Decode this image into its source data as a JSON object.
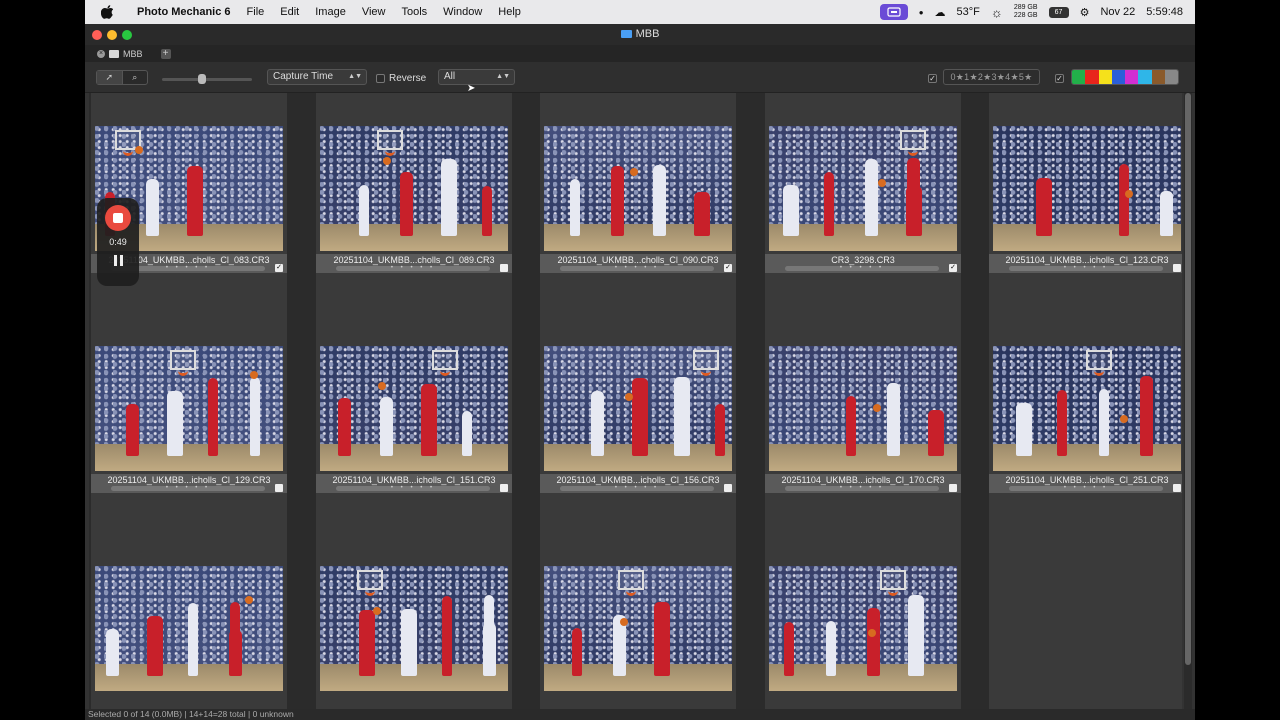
{
  "menubar": {
    "app_name": "Photo Mechanic 6",
    "items": [
      "File",
      "Edit",
      "Image",
      "View",
      "Tools",
      "Window",
      "Help"
    ],
    "temperature": "53°F",
    "storage_line1": "289 GB",
    "storage_line2": "228 GB",
    "battery": "67",
    "date": "Nov 22",
    "time": "5:59:48"
  },
  "window": {
    "title": "MBB",
    "tab_label": "MBB"
  },
  "toolbar": {
    "sort_value": "Capture Time",
    "reverse_label": "Reverse",
    "filter_value": "All",
    "stars_text": "0★1★2★3★4★5★",
    "color_labels": [
      "#22b04a",
      "#e8251c",
      "#f5e11b",
      "#2b5fd9",
      "#d22fd2",
      "#2fb6e8",
      "#8a5a2b",
      "#888888"
    ]
  },
  "recorder": {
    "elapsed": "0:49"
  },
  "cells": [
    {
      "filename": "20251104_UKMBB...cholls_Cl_083.CR3",
      "tagged": true
    },
    {
      "filename": "20251104_UKMBB...cholls_Cl_089.CR3",
      "tagged": false
    },
    {
      "filename": "20251104_UKMBB...cholls_Cl_090.CR3",
      "tagged": true
    },
    {
      "filename": "CR3_3298.CR3",
      "tagged": true
    },
    {
      "filename": "20251104_UKMBB...icholls_Cl_123.CR3",
      "tagged": false
    },
    {
      "filename": "20251104_UKMBB...icholls_Cl_129.CR3",
      "tagged": false
    },
    {
      "filename": "20251104_UKMBB...icholls_Cl_151.CR3",
      "tagged": false
    },
    {
      "filename": "20251104_UKMBB...icholls_Cl_156.CR3",
      "tagged": false
    },
    {
      "filename": "20251104_UKMBB...icholls_Cl_170.CR3",
      "tagged": false
    },
    {
      "filename": "20251104_UKMBB...icholls_Cl_251.CR3",
      "tagged": false
    },
    {
      "filename": "",
      "tagged": false
    },
    {
      "filename": "",
      "tagged": false
    },
    {
      "filename": "",
      "tagged": false
    },
    {
      "filename": "",
      "tagged": false
    }
  ],
  "status_text": "Selected 0 of 14 (0.0MB) | 14+14=28 total | 0 unknown"
}
